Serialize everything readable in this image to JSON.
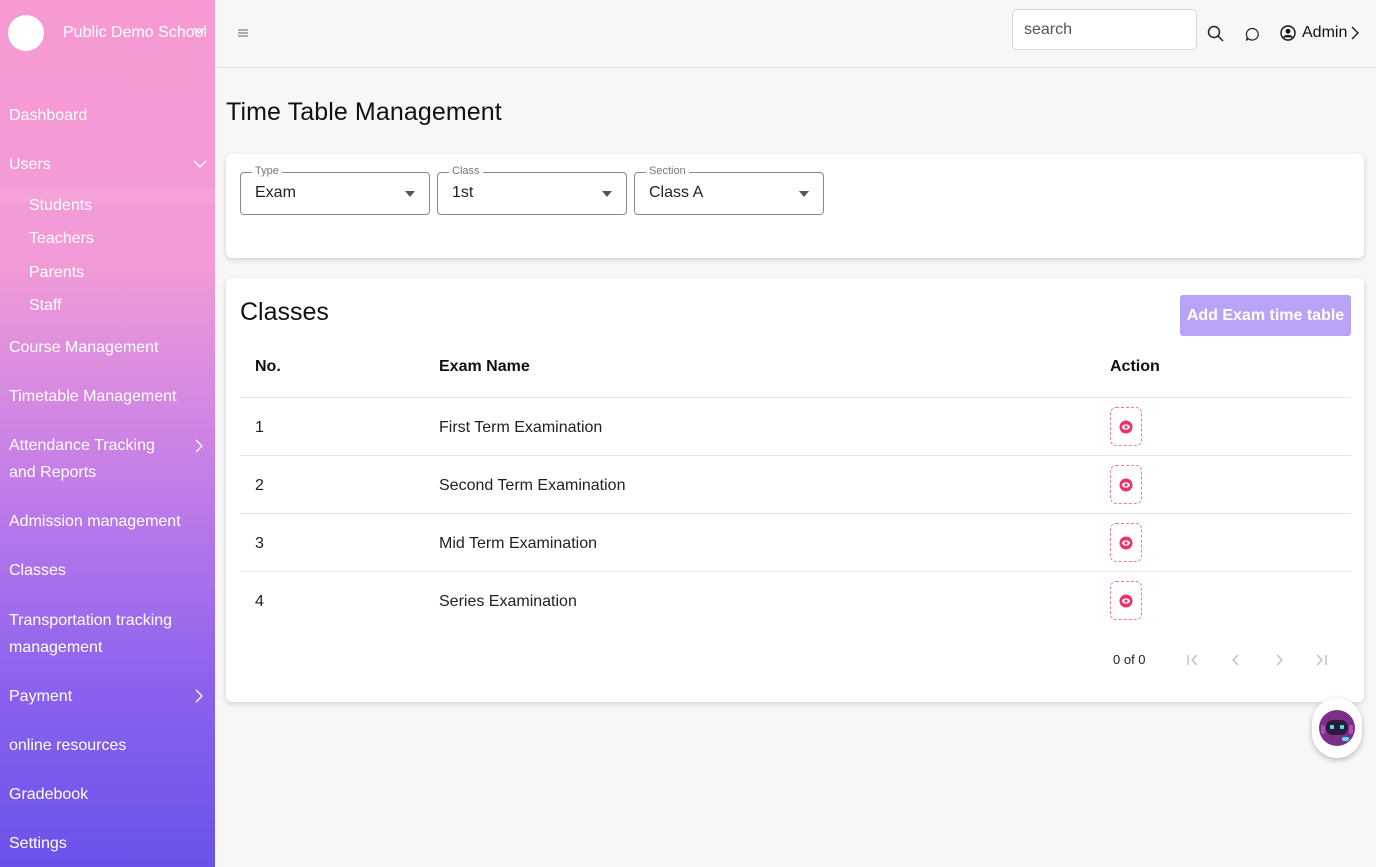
{
  "school": {
    "name": "Public Demo School"
  },
  "sidebar": {
    "items": [
      {
        "label": "Dashboard"
      },
      {
        "label": "Users"
      },
      {
        "label": "Course Management"
      },
      {
        "label": "Timetable Management"
      },
      {
        "label": "Attendance Tracking and Reports"
      },
      {
        "label": "Admission management"
      },
      {
        "label": "Classes"
      },
      {
        "label": "Transportation tracking management"
      },
      {
        "label": "Payment"
      },
      {
        "label": "online resources"
      },
      {
        "label": "Gradebook"
      },
      {
        "label": "Settings"
      }
    ],
    "users_sub": [
      {
        "label": "Students"
      },
      {
        "label": "Teachers"
      },
      {
        "label": "Parents"
      },
      {
        "label": "Staff"
      }
    ]
  },
  "topbar": {
    "search_placeholder": "search",
    "user_label": "Admin"
  },
  "page": {
    "title": "Time Table Management"
  },
  "filters": {
    "type": {
      "label": "Type",
      "value": "Exam"
    },
    "class": {
      "label": "Class",
      "value": "1st"
    },
    "section": {
      "label": "Section",
      "value": "Class A"
    }
  },
  "classes": {
    "title": "Classes",
    "add_button": "Add Exam time table",
    "columns": [
      "No.",
      "Exam Name",
      "Action"
    ],
    "rows": [
      {
        "no": "1",
        "name": "First Term Examination"
      },
      {
        "no": "2",
        "name": "Second Term Examination"
      },
      {
        "no": "3",
        "name": "Mid Term Examination"
      },
      {
        "no": "4",
        "name": "Series Examination"
      }
    ],
    "pagination": "0 of 0"
  },
  "colors": {
    "accent": "#b8a3f6",
    "view_icon": "#e8336a",
    "sidebar_top": "#f79ad3",
    "sidebar_bottom": "#6a52ea"
  },
  "icons": {
    "menu": "hamburger-icon",
    "search": "search-icon",
    "chat": "chat-icon",
    "user": "user-circle-icon",
    "view": "eye-icon",
    "bot": "chatbot-avatar-icon"
  }
}
